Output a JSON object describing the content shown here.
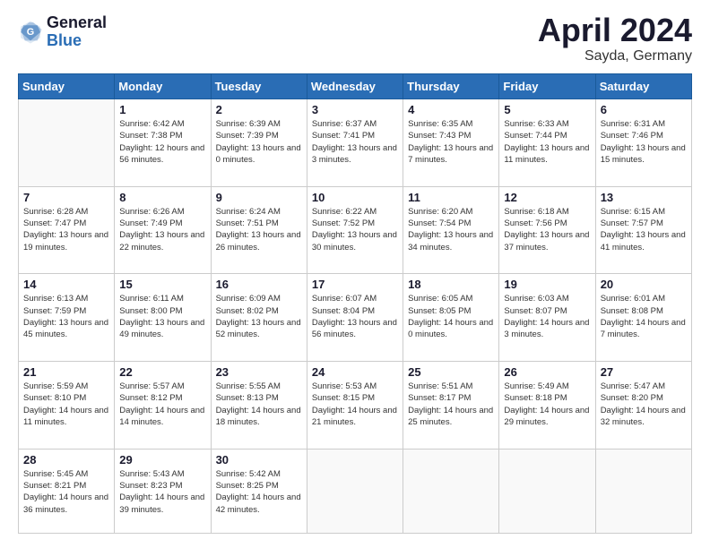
{
  "logo": {
    "line1": "General",
    "line2": "Blue"
  },
  "title": "April 2024",
  "location": "Sayda, Germany",
  "days_of_week": [
    "Sunday",
    "Monday",
    "Tuesday",
    "Wednesday",
    "Thursday",
    "Friday",
    "Saturday"
  ],
  "weeks": [
    [
      {
        "day": "",
        "sunrise": "",
        "sunset": "",
        "daylight": ""
      },
      {
        "day": "1",
        "sunrise": "Sunrise: 6:42 AM",
        "sunset": "Sunset: 7:38 PM",
        "daylight": "Daylight: 12 hours and 56 minutes."
      },
      {
        "day": "2",
        "sunrise": "Sunrise: 6:39 AM",
        "sunset": "Sunset: 7:39 PM",
        "daylight": "Daylight: 13 hours and 0 minutes."
      },
      {
        "day": "3",
        "sunrise": "Sunrise: 6:37 AM",
        "sunset": "Sunset: 7:41 PM",
        "daylight": "Daylight: 13 hours and 3 minutes."
      },
      {
        "day": "4",
        "sunrise": "Sunrise: 6:35 AM",
        "sunset": "Sunset: 7:43 PM",
        "daylight": "Daylight: 13 hours and 7 minutes."
      },
      {
        "day": "5",
        "sunrise": "Sunrise: 6:33 AM",
        "sunset": "Sunset: 7:44 PM",
        "daylight": "Daylight: 13 hours and 11 minutes."
      },
      {
        "day": "6",
        "sunrise": "Sunrise: 6:31 AM",
        "sunset": "Sunset: 7:46 PM",
        "daylight": "Daylight: 13 hours and 15 minutes."
      }
    ],
    [
      {
        "day": "7",
        "sunrise": "Sunrise: 6:28 AM",
        "sunset": "Sunset: 7:47 PM",
        "daylight": "Daylight: 13 hours and 19 minutes."
      },
      {
        "day": "8",
        "sunrise": "Sunrise: 6:26 AM",
        "sunset": "Sunset: 7:49 PM",
        "daylight": "Daylight: 13 hours and 22 minutes."
      },
      {
        "day": "9",
        "sunrise": "Sunrise: 6:24 AM",
        "sunset": "Sunset: 7:51 PM",
        "daylight": "Daylight: 13 hours and 26 minutes."
      },
      {
        "day": "10",
        "sunrise": "Sunrise: 6:22 AM",
        "sunset": "Sunset: 7:52 PM",
        "daylight": "Daylight: 13 hours and 30 minutes."
      },
      {
        "day": "11",
        "sunrise": "Sunrise: 6:20 AM",
        "sunset": "Sunset: 7:54 PM",
        "daylight": "Daylight: 13 hours and 34 minutes."
      },
      {
        "day": "12",
        "sunrise": "Sunrise: 6:18 AM",
        "sunset": "Sunset: 7:56 PM",
        "daylight": "Daylight: 13 hours and 37 minutes."
      },
      {
        "day": "13",
        "sunrise": "Sunrise: 6:15 AM",
        "sunset": "Sunset: 7:57 PM",
        "daylight": "Daylight: 13 hours and 41 minutes."
      }
    ],
    [
      {
        "day": "14",
        "sunrise": "Sunrise: 6:13 AM",
        "sunset": "Sunset: 7:59 PM",
        "daylight": "Daylight: 13 hours and 45 minutes."
      },
      {
        "day": "15",
        "sunrise": "Sunrise: 6:11 AM",
        "sunset": "Sunset: 8:00 PM",
        "daylight": "Daylight: 13 hours and 49 minutes."
      },
      {
        "day": "16",
        "sunrise": "Sunrise: 6:09 AM",
        "sunset": "Sunset: 8:02 PM",
        "daylight": "Daylight: 13 hours and 52 minutes."
      },
      {
        "day": "17",
        "sunrise": "Sunrise: 6:07 AM",
        "sunset": "Sunset: 8:04 PM",
        "daylight": "Daylight: 13 hours and 56 minutes."
      },
      {
        "day": "18",
        "sunrise": "Sunrise: 6:05 AM",
        "sunset": "Sunset: 8:05 PM",
        "daylight": "Daylight: 14 hours and 0 minutes."
      },
      {
        "day": "19",
        "sunrise": "Sunrise: 6:03 AM",
        "sunset": "Sunset: 8:07 PM",
        "daylight": "Daylight: 14 hours and 3 minutes."
      },
      {
        "day": "20",
        "sunrise": "Sunrise: 6:01 AM",
        "sunset": "Sunset: 8:08 PM",
        "daylight": "Daylight: 14 hours and 7 minutes."
      }
    ],
    [
      {
        "day": "21",
        "sunrise": "Sunrise: 5:59 AM",
        "sunset": "Sunset: 8:10 PM",
        "daylight": "Daylight: 14 hours and 11 minutes."
      },
      {
        "day": "22",
        "sunrise": "Sunrise: 5:57 AM",
        "sunset": "Sunset: 8:12 PM",
        "daylight": "Daylight: 14 hours and 14 minutes."
      },
      {
        "day": "23",
        "sunrise": "Sunrise: 5:55 AM",
        "sunset": "Sunset: 8:13 PM",
        "daylight": "Daylight: 14 hours and 18 minutes."
      },
      {
        "day": "24",
        "sunrise": "Sunrise: 5:53 AM",
        "sunset": "Sunset: 8:15 PM",
        "daylight": "Daylight: 14 hours and 21 minutes."
      },
      {
        "day": "25",
        "sunrise": "Sunrise: 5:51 AM",
        "sunset": "Sunset: 8:17 PM",
        "daylight": "Daylight: 14 hours and 25 minutes."
      },
      {
        "day": "26",
        "sunrise": "Sunrise: 5:49 AM",
        "sunset": "Sunset: 8:18 PM",
        "daylight": "Daylight: 14 hours and 29 minutes."
      },
      {
        "day": "27",
        "sunrise": "Sunrise: 5:47 AM",
        "sunset": "Sunset: 8:20 PM",
        "daylight": "Daylight: 14 hours and 32 minutes."
      }
    ],
    [
      {
        "day": "28",
        "sunrise": "Sunrise: 5:45 AM",
        "sunset": "Sunset: 8:21 PM",
        "daylight": "Daylight: 14 hours and 36 minutes."
      },
      {
        "day": "29",
        "sunrise": "Sunrise: 5:43 AM",
        "sunset": "Sunset: 8:23 PM",
        "daylight": "Daylight: 14 hours and 39 minutes."
      },
      {
        "day": "30",
        "sunrise": "Sunrise: 5:42 AM",
        "sunset": "Sunset: 8:25 PM",
        "daylight": "Daylight: 14 hours and 42 minutes."
      },
      {
        "day": "",
        "sunrise": "",
        "sunset": "",
        "daylight": ""
      },
      {
        "day": "",
        "sunrise": "",
        "sunset": "",
        "daylight": ""
      },
      {
        "day": "",
        "sunrise": "",
        "sunset": "",
        "daylight": ""
      },
      {
        "day": "",
        "sunrise": "",
        "sunset": "",
        "daylight": ""
      }
    ]
  ]
}
